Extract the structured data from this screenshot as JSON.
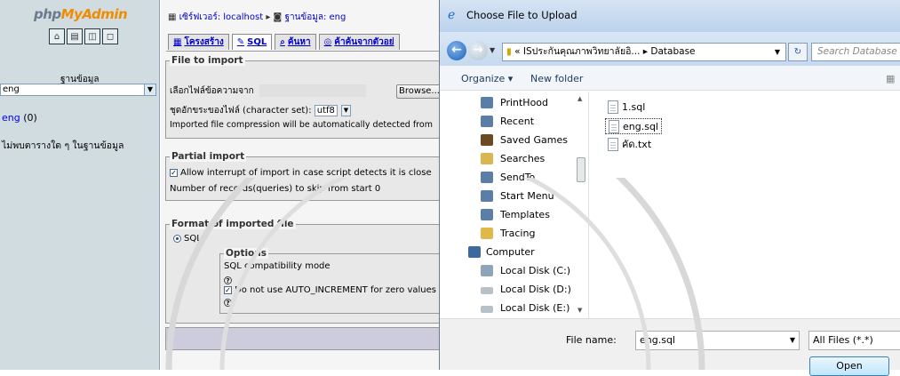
{
  "left": {
    "logo_php": "php",
    "logo_my": "MyAdmin",
    "db_label": "ฐานข้อมูล",
    "db_select": "eng",
    "db_link": "eng",
    "db_count": "(0)",
    "no_table": "ไม่พบตารางใด ๆ ในฐานข้อมูล"
  },
  "main": {
    "crumb_server": "เซิร์ฟเวอร์: localhost",
    "crumb_db": "ฐานข้อมูล: eng",
    "tabs": [
      "โครงสร้าง",
      "SQL",
      "ค้นหา",
      "ค้าค้นจากตัวอย่"
    ],
    "file_import_legend": "File to import",
    "file_label": "เลือกไฟล์ข้อความจาก",
    "browse": "Browse...",
    "charset_label": "ชุดอักขระของไฟล์ (character set):",
    "charset_value": "utf8",
    "compression_note": "Imported file compression will be automatically detected from",
    "partial_legend": "Partial import",
    "allow_interrupt": "Allow interrupt of import in case script detects it is close",
    "skip_label": "Number of records(queries) to skip from start",
    "skip_value": "0",
    "format_legend": "Format of imported file",
    "format_sql": "SQL",
    "options_legend": "Options",
    "sql_compat": "SQL compatibility mode",
    "no_auto_inc": "Do not use AUTO_INCREMENT for zero values"
  },
  "dialog": {
    "title": "Choose File to Upload",
    "path_prefix": "«",
    "path_folder": "ISประกันคุณภาพวิทยาลัยอิ...",
    "path_sep": "▸",
    "path_current": "Database",
    "search_placeholder": "Search Database",
    "organize": "Organize ▾",
    "new_folder": "New folder",
    "nav_items": [
      "PrintHood",
      "Recent",
      "Saved Games",
      "Searches",
      "SendTo",
      "Start Menu",
      "Templates",
      "Tracing",
      "Computer",
      "Local Disk (C:)",
      "Local Disk (D:)",
      "Local Disk (E:)"
    ],
    "files": [
      "1.sql",
      "eng.sql",
      "คัด.txt"
    ],
    "file_name_label": "File name:",
    "file_name_value": "eng.sql",
    "file_type": "All Files (*.*)",
    "open": "Open"
  },
  "colors": {
    "pma_bg": "#d0dce0",
    "dialog_title": "#bcd2ec",
    "link": "#0000cc"
  }
}
